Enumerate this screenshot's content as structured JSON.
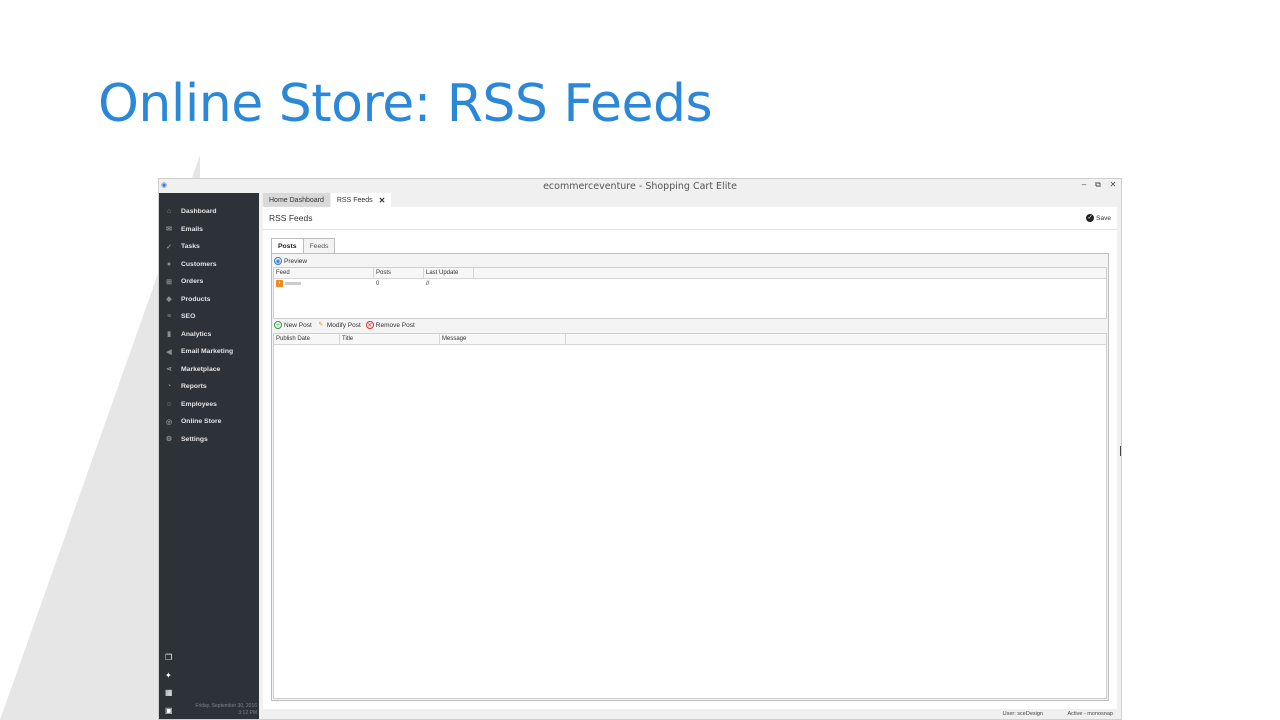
{
  "slide": {
    "title": "Online Store: RSS Feeds"
  },
  "window": {
    "title": "ecommerceventure - Shopping Cart Elite",
    "controls": {
      "minimize": "–",
      "restore": "⧉",
      "close": "✕"
    }
  },
  "sidebar": {
    "items": [
      {
        "label": "Dashboard",
        "icon": "home-icon",
        "glyph": "⌂"
      },
      {
        "label": "Emails",
        "icon": "mail-icon",
        "glyph": "✉"
      },
      {
        "label": "Tasks",
        "icon": "tasks-icon",
        "glyph": "✓"
      },
      {
        "label": "Customers",
        "icon": "user-icon",
        "glyph": "●"
      },
      {
        "label": "Orders",
        "icon": "cart-icon",
        "glyph": "⊞"
      },
      {
        "label": "Products",
        "icon": "tag-icon",
        "glyph": "◆"
      },
      {
        "label": "SEO",
        "icon": "seo-icon",
        "glyph": "≡"
      },
      {
        "label": "Analytics",
        "icon": "bar-chart-icon",
        "glyph": "▮"
      },
      {
        "label": "Email Marketing",
        "icon": "megaphone-icon",
        "glyph": "◀"
      },
      {
        "label": "Marketplace",
        "icon": "share-icon",
        "glyph": "⋖"
      },
      {
        "label": "Reports",
        "icon": "pie-chart-icon",
        "glyph": "◔"
      },
      {
        "label": "Employees",
        "icon": "group-icon",
        "glyph": "☺"
      },
      {
        "label": "Online Store",
        "icon": "globe-icon",
        "glyph": "◎"
      },
      {
        "label": "Settings",
        "icon": "search-gear-icon",
        "glyph": "⚙"
      }
    ],
    "tools": [
      {
        "icon": "windows-icon",
        "glyph": "❐"
      },
      {
        "icon": "lightbulb-icon",
        "glyph": "✦"
      },
      {
        "icon": "calculator-icon",
        "glyph": "▦"
      },
      {
        "icon": "calendar-icon",
        "glyph": "▣"
      },
      {
        "icon": "more-icon",
        "glyph": "•••"
      }
    ],
    "date": "Friday, September 30, 2016",
    "time": "3:12 PM"
  },
  "doc_tabs": {
    "home": "Home Dashboard",
    "rss": "RSS Feeds",
    "close_glyph": "✕"
  },
  "panel": {
    "title": "RSS Feeds",
    "save_label": "Save",
    "save_glyph": "✓"
  },
  "inner_tabs": {
    "posts": "Posts",
    "feeds": "Feeds"
  },
  "preview_label": "Preview",
  "feeds_grid": {
    "columns": [
      "Feed",
      "Posts",
      "Last Update"
    ],
    "rows": [
      {
        "posts": "0",
        "last_update": "//"
      }
    ]
  },
  "posts_toolbar": {
    "new": "New Post",
    "modify": "Modify Post",
    "remove": "Remove Post"
  },
  "posts_grid": {
    "columns": [
      "Publish Date",
      "Title",
      "Message"
    ]
  },
  "status": {
    "user": "User: sceDesign",
    "active": "Active - monosnap"
  },
  "colors": {
    "title_blue": "#2b88d8",
    "sidebar_bg": "#2d3138",
    "rss_orange": "#f2891d"
  }
}
